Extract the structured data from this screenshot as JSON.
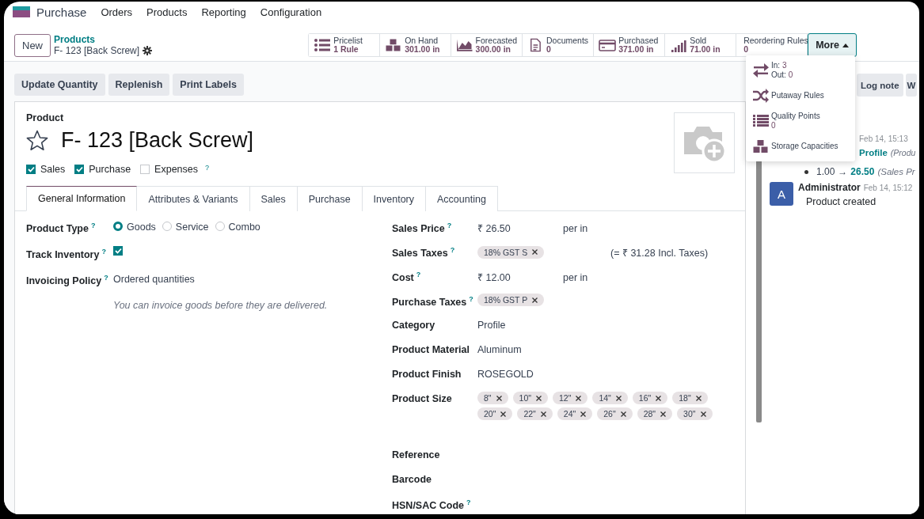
{
  "navbar": {
    "app": "Purchase",
    "menu": [
      "Orders",
      "Products",
      "Reporting",
      "Configuration"
    ]
  },
  "control_panel": {
    "new_button": "New",
    "breadcrumb_parent": "Products",
    "breadcrumb_current": "F- 123 [Back Screw]"
  },
  "stat_buttons": [
    {
      "kind": "pricelist",
      "label": "Pricelist",
      "value": "1 Rule"
    },
    {
      "kind": "on-hand",
      "label": "On Hand",
      "value": "301.00 in"
    },
    {
      "kind": "forecasted",
      "label": "Forecasted",
      "value": "300.00 in"
    },
    {
      "kind": "documents",
      "label": "Documents",
      "value": "0"
    },
    {
      "kind": "purchased",
      "label": "Purchased",
      "value": "371.00 in"
    },
    {
      "kind": "sold",
      "label": "Sold",
      "value": "71.00 in"
    },
    {
      "kind": "reordering",
      "label": "Reordering Rules",
      "value": "0"
    }
  ],
  "more_button": {
    "label": "More",
    "expanded": true
  },
  "more_menu": [
    {
      "kind": "moves",
      "in_label": "In:",
      "in_value": "3",
      "out_label": "Out:",
      "out_value": "0"
    },
    {
      "kind": "putaway",
      "label": "Putaway Rules"
    },
    {
      "kind": "quality",
      "label": "Quality Points",
      "value": "0"
    },
    {
      "kind": "storage",
      "label": "Storage Capacities"
    }
  ],
  "action_buttons": [
    "Update Quantity",
    "Replenish",
    "Print Labels"
  ],
  "product": {
    "label": "Product",
    "name": "F- 123 [Back Screw]",
    "favorite": false,
    "options": [
      {
        "label": "Sales",
        "checked": true
      },
      {
        "label": "Purchase",
        "checked": true
      },
      {
        "label": "Expenses",
        "checked": false,
        "help": "?"
      }
    ]
  },
  "tabs": [
    {
      "label": "General Information",
      "selected": true
    },
    {
      "label": "Attributes & Variants",
      "selected": false
    },
    {
      "label": "Sales",
      "selected": false
    },
    {
      "label": "Purchase",
      "selected": false
    },
    {
      "label": "Inventory",
      "selected": false
    },
    {
      "label": "Accounting",
      "selected": false
    }
  ],
  "left_fields": [
    {
      "kind": "radio",
      "label": "Product Type",
      "help": "?",
      "options": [
        {
          "label": "Goods",
          "selected": true
        },
        {
          "label": "Service",
          "selected": false
        },
        {
          "label": "Combo",
          "selected": false
        }
      ]
    },
    {
      "kind": "checkbox",
      "label": "Track Inventory",
      "help": "?",
      "checked": true
    },
    {
      "kind": "text",
      "label": "Invoicing Policy",
      "help": "?",
      "value": "Ordered quantities",
      "note": "You can invoice goods before they are delivered."
    }
  ],
  "right_fields": [
    {
      "kind": "money",
      "label": "Sales Price",
      "help": "?",
      "value": "₹ 26.50",
      "unit": "per in"
    },
    {
      "kind": "tags",
      "label": "Sales Taxes",
      "help": "?",
      "tags": [
        "18% GST S"
      ],
      "note": "(= ₹ 31.28 Incl. Taxes)"
    },
    {
      "kind": "money",
      "label": "Cost",
      "help": "?",
      "value": "₹ 12.00",
      "unit": "per in"
    },
    {
      "kind": "tags",
      "label": "Purchase Taxes",
      "help": "?",
      "tags": [
        "18% GST P"
      ]
    },
    {
      "kind": "text",
      "label": "Category",
      "value": "Profile"
    },
    {
      "kind": "text",
      "label": "Product Material",
      "value": "Aluminum"
    },
    {
      "kind": "text",
      "label": "Product Finish",
      "value": "ROSEGOLD"
    },
    {
      "kind": "tags",
      "label": "Product Size",
      "tags": [
        "8\"",
        "10\"",
        "12\"",
        "14\"",
        "16\"",
        "18\"",
        "20\"",
        "22\"",
        "24\"",
        "26\"",
        "28\"",
        "30\""
      ]
    },
    {
      "kind": "empty",
      "label": "Reference"
    },
    {
      "kind": "empty",
      "label": "Barcode"
    },
    {
      "kind": "empty",
      "label": "HSN/SAC Code",
      "help": "?"
    }
  ],
  "chatter": {
    "buttons": [
      "Log note",
      "W"
    ],
    "tracking_message": {
      "date": "Feb 14, 15:13",
      "line_1": {
        "new": "Profile",
        "field": "(Produ"
      },
      "line_2": {
        "old": "1.00",
        "arrow": "→",
        "new": "26.50",
        "field": "(Sales Pr"
      }
    },
    "message": {
      "avatar": "A",
      "author": "Administrator",
      "date": "Feb 14, 15:12",
      "body": "Product created"
    }
  }
}
